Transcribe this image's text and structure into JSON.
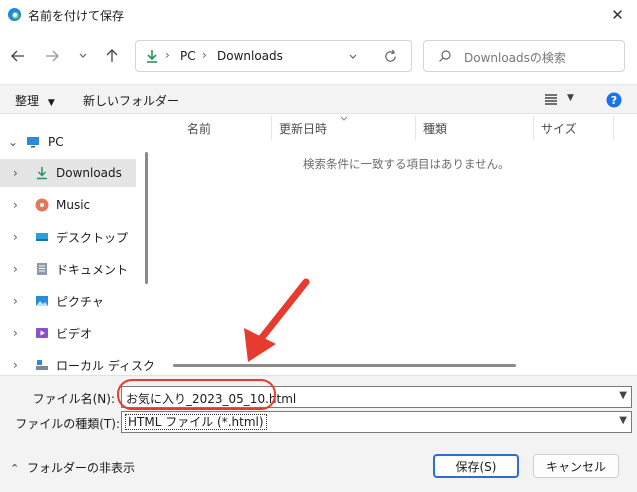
{
  "window": {
    "title": "名前を付けて保存",
    "close_glyph": "✕"
  },
  "address": {
    "path": [
      "PC",
      "Downloads"
    ],
    "separator": "›",
    "search_placeholder": "Downloadsの検索"
  },
  "toolbar": {
    "organize": "整理",
    "new_folder": "新しいフォルダー"
  },
  "nav": {
    "items": [
      {
        "label": "PC",
        "icon": "pc-icon"
      },
      {
        "label": "Downloads",
        "icon": "downloads-icon",
        "selected": true
      },
      {
        "label": "Music",
        "icon": "music-icon"
      },
      {
        "label": "デスクトップ",
        "icon": "desktop-icon"
      },
      {
        "label": "ドキュメント",
        "icon": "documents-icon"
      },
      {
        "label": "ピクチャ",
        "icon": "pictures-icon"
      },
      {
        "label": "ビデオ",
        "icon": "videos-icon"
      },
      {
        "label": "ローカル ディスク (",
        "icon": "local-disk-icon"
      }
    ]
  },
  "columns": [
    "名前",
    "更新日時",
    "種類",
    "サイズ"
  ],
  "empty_message": "検索条件に一致する項目はありません。",
  "form": {
    "filename_label": "ファイル名(N):",
    "filename_value": "お気に入り_2023_05_10.html",
    "filetype_label": "ファイルの種類(T):",
    "filetype_value": "HTML ファイル (*.html)",
    "hide_folders": "フォルダーの非表示",
    "save": "保存(S)",
    "cancel": "キャンセル"
  },
  "colors": {
    "accent": "#2a6fd1",
    "annotation": "#e63b2e"
  }
}
